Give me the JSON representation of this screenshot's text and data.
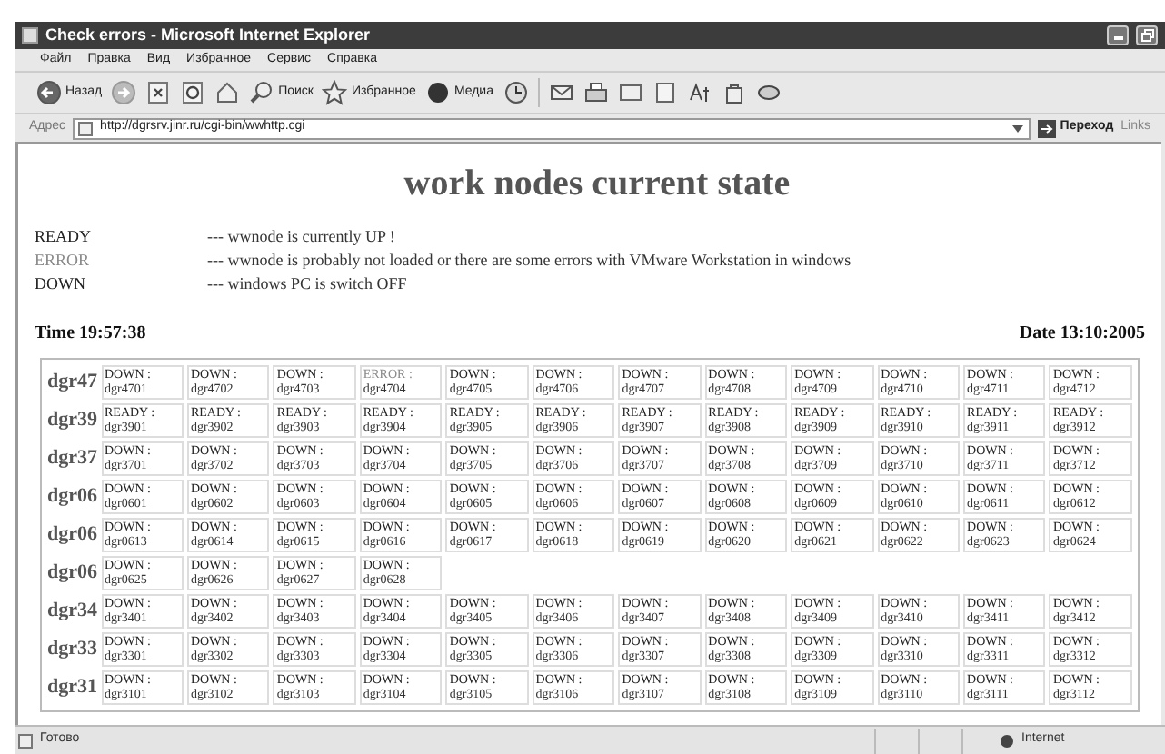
{
  "window": {
    "title": "Check errors - Microsoft Internet Explorer"
  },
  "menu": [
    "Файл",
    "Правка",
    "Вид",
    "Избранное",
    "Сервис",
    "Справка"
  ],
  "toolbar": {
    "back": "Назад",
    "search": "Поиск",
    "favorites": "Избранное",
    "media": "Медиа"
  },
  "address": {
    "label": "Адрес",
    "url": "http://dgrsrv.jinr.ru/cgi-bin/wwhttp.cgi",
    "go": "Переход",
    "links": "Links"
  },
  "page": {
    "heading": "work nodes current state",
    "legend": [
      {
        "kind": "ready",
        "state": "READY",
        "description": "--- wwnode is currently UP !"
      },
      {
        "kind": "error",
        "state": "ERROR",
        "description": "--- wwnode is probably not loaded or there are some errors with VMware Workstation in windows"
      },
      {
        "kind": "down",
        "state": "DOWN",
        "description": "--- windows PC is switch OFF"
      }
    ],
    "time": "Time 19:57:38",
    "date": "Date 13:10:2005",
    "groups": [
      {
        "name": "dgr47",
        "nodes": [
          {
            "kind": "down",
            "status": "DOWN :",
            "node": "dgr4701"
          },
          {
            "kind": "down",
            "status": "DOWN :",
            "node": "dgr4702"
          },
          {
            "kind": "down",
            "status": "DOWN :",
            "node": "dgr4703"
          },
          {
            "kind": "error",
            "status": "ERROR :",
            "node": "dgr4704"
          },
          {
            "kind": "down",
            "status": "DOWN :",
            "node": "dgr4705"
          },
          {
            "kind": "down",
            "status": "DOWN :",
            "node": "dgr4706"
          },
          {
            "kind": "down",
            "status": "DOWN :",
            "node": "dgr4707"
          },
          {
            "kind": "down",
            "status": "DOWN :",
            "node": "dgr4708"
          },
          {
            "kind": "down",
            "status": "DOWN :",
            "node": "dgr4709"
          },
          {
            "kind": "down",
            "status": "DOWN :",
            "node": "dgr4710"
          },
          {
            "kind": "down",
            "status": "DOWN :",
            "node": "dgr4711"
          },
          {
            "kind": "down",
            "status": "DOWN :",
            "node": "dgr4712"
          }
        ]
      },
      {
        "name": "dgr39",
        "nodes": [
          {
            "kind": "ready",
            "status": "READY :",
            "node": "dgr3901"
          },
          {
            "kind": "ready",
            "status": "READY :",
            "node": "dgr3902"
          },
          {
            "kind": "ready",
            "status": "READY :",
            "node": "dgr3903"
          },
          {
            "kind": "ready",
            "status": "READY :",
            "node": "dgr3904"
          },
          {
            "kind": "ready",
            "status": "READY :",
            "node": "dgr3905"
          },
          {
            "kind": "ready",
            "status": "READY :",
            "node": "dgr3906"
          },
          {
            "kind": "ready",
            "status": "READY :",
            "node": "dgr3907"
          },
          {
            "kind": "ready",
            "status": "READY :",
            "node": "dgr3908"
          },
          {
            "kind": "ready",
            "status": "READY :",
            "node": "dgr3909"
          },
          {
            "kind": "ready",
            "status": "READY :",
            "node": "dgr3910"
          },
          {
            "kind": "ready",
            "status": "READY :",
            "node": "dgr3911"
          },
          {
            "kind": "ready",
            "status": "READY :",
            "node": "dgr3912"
          }
        ]
      },
      {
        "name": "dgr37",
        "nodes": [
          {
            "kind": "down",
            "status": "DOWN :",
            "node": "dgr3701"
          },
          {
            "kind": "down",
            "status": "DOWN :",
            "node": "dgr3702"
          },
          {
            "kind": "down",
            "status": "DOWN :",
            "node": "dgr3703"
          },
          {
            "kind": "down",
            "status": "DOWN :",
            "node": "dgr3704"
          },
          {
            "kind": "down",
            "status": "DOWN :",
            "node": "dgr3705"
          },
          {
            "kind": "down",
            "status": "DOWN :",
            "node": "dgr3706"
          },
          {
            "kind": "down",
            "status": "DOWN :",
            "node": "dgr3707"
          },
          {
            "kind": "down",
            "status": "DOWN :",
            "node": "dgr3708"
          },
          {
            "kind": "down",
            "status": "DOWN :",
            "node": "dgr3709"
          },
          {
            "kind": "down",
            "status": "DOWN :",
            "node": "dgr3710"
          },
          {
            "kind": "down",
            "status": "DOWN :",
            "node": "dgr3711"
          },
          {
            "kind": "down",
            "status": "DOWN :",
            "node": "dgr3712"
          }
        ]
      },
      {
        "name": "dgr06",
        "nodes": [
          {
            "kind": "down",
            "status": "DOWN :",
            "node": "dgr0601"
          },
          {
            "kind": "down",
            "status": "DOWN :",
            "node": "dgr0602"
          },
          {
            "kind": "down",
            "status": "DOWN :",
            "node": "dgr0603"
          },
          {
            "kind": "down",
            "status": "DOWN :",
            "node": "dgr0604"
          },
          {
            "kind": "down",
            "status": "DOWN :",
            "node": "dgr0605"
          },
          {
            "kind": "down",
            "status": "DOWN :",
            "node": "dgr0606"
          },
          {
            "kind": "down",
            "status": "DOWN :",
            "node": "dgr0607"
          },
          {
            "kind": "down",
            "status": "DOWN :",
            "node": "dgr0608"
          },
          {
            "kind": "down",
            "status": "DOWN :",
            "node": "dgr0609"
          },
          {
            "kind": "down",
            "status": "DOWN :",
            "node": "dgr0610"
          },
          {
            "kind": "down",
            "status": "DOWN :",
            "node": "dgr0611"
          },
          {
            "kind": "down",
            "status": "DOWN :",
            "node": "dgr0612"
          }
        ]
      },
      {
        "name": "dgr06",
        "nodes": [
          {
            "kind": "down",
            "status": "DOWN :",
            "node": "dgr0613"
          },
          {
            "kind": "down",
            "status": "DOWN :",
            "node": "dgr0614"
          },
          {
            "kind": "down",
            "status": "DOWN :",
            "node": "dgr0615"
          },
          {
            "kind": "down",
            "status": "DOWN :",
            "node": "dgr0616"
          },
          {
            "kind": "down",
            "status": "DOWN :",
            "node": "dgr0617"
          },
          {
            "kind": "down",
            "status": "DOWN :",
            "node": "dgr0618"
          },
          {
            "kind": "down",
            "status": "DOWN :",
            "node": "dgr0619"
          },
          {
            "kind": "down",
            "status": "DOWN :",
            "node": "dgr0620"
          },
          {
            "kind": "down",
            "status": "DOWN :",
            "node": "dgr0621"
          },
          {
            "kind": "down",
            "status": "DOWN :",
            "node": "dgr0622"
          },
          {
            "kind": "down",
            "status": "DOWN :",
            "node": "dgr0623"
          },
          {
            "kind": "down",
            "status": "DOWN :",
            "node": "dgr0624"
          }
        ]
      },
      {
        "name": "dgr06",
        "nodes": [
          {
            "kind": "down",
            "status": "DOWN :",
            "node": "dgr0625"
          },
          {
            "kind": "down",
            "status": "DOWN :",
            "node": "dgr0626"
          },
          {
            "kind": "down",
            "status": "DOWN :",
            "node": "dgr0627"
          },
          {
            "kind": "down",
            "status": "DOWN :",
            "node": "dgr0628"
          }
        ]
      },
      {
        "name": "dgr34",
        "nodes": [
          {
            "kind": "down",
            "status": "DOWN :",
            "node": "dgr3401"
          },
          {
            "kind": "down",
            "status": "DOWN :",
            "node": "dgr3402"
          },
          {
            "kind": "down",
            "status": "DOWN :",
            "node": "dgr3403"
          },
          {
            "kind": "down",
            "status": "DOWN :",
            "node": "dgr3404"
          },
          {
            "kind": "down",
            "status": "DOWN :",
            "node": "dgr3405"
          },
          {
            "kind": "down",
            "status": "DOWN :",
            "node": "dgr3406"
          },
          {
            "kind": "down",
            "status": "DOWN :",
            "node": "dgr3407"
          },
          {
            "kind": "down",
            "status": "DOWN :",
            "node": "dgr3408"
          },
          {
            "kind": "down",
            "status": "DOWN :",
            "node": "dgr3409"
          },
          {
            "kind": "down",
            "status": "DOWN :",
            "node": "dgr3410"
          },
          {
            "kind": "down",
            "status": "DOWN :",
            "node": "dgr3411"
          },
          {
            "kind": "down",
            "status": "DOWN :",
            "node": "dgr3412"
          }
        ]
      },
      {
        "name": "dgr33",
        "nodes": [
          {
            "kind": "down",
            "status": "DOWN :",
            "node": "dgr3301"
          },
          {
            "kind": "down",
            "status": "DOWN :",
            "node": "dgr3302"
          },
          {
            "kind": "down",
            "status": "DOWN :",
            "node": "dgr3303"
          },
          {
            "kind": "down",
            "status": "DOWN :",
            "node": "dgr3304"
          },
          {
            "kind": "down",
            "status": "DOWN :",
            "node": "dgr3305"
          },
          {
            "kind": "down",
            "status": "DOWN :",
            "node": "dgr3306"
          },
          {
            "kind": "down",
            "status": "DOWN :",
            "node": "dgr3307"
          },
          {
            "kind": "down",
            "status": "DOWN :",
            "node": "dgr3308"
          },
          {
            "kind": "down",
            "status": "DOWN :",
            "node": "dgr3309"
          },
          {
            "kind": "down",
            "status": "DOWN :",
            "node": "dgr3310"
          },
          {
            "kind": "down",
            "status": "DOWN :",
            "node": "dgr3311"
          },
          {
            "kind": "down",
            "status": "DOWN :",
            "node": "dgr3312"
          }
        ]
      },
      {
        "name": "dgr31",
        "nodes": [
          {
            "kind": "down",
            "status": "DOWN :",
            "node": "dgr3101"
          },
          {
            "kind": "down",
            "status": "DOWN :",
            "node": "dgr3102"
          },
          {
            "kind": "down",
            "status": "DOWN :",
            "node": "dgr3103"
          },
          {
            "kind": "down",
            "status": "DOWN :",
            "node": "dgr3104"
          },
          {
            "kind": "down",
            "status": "DOWN :",
            "node": "dgr3105"
          },
          {
            "kind": "down",
            "status": "DOWN :",
            "node": "dgr3106"
          },
          {
            "kind": "down",
            "status": "DOWN :",
            "node": "dgr3107"
          },
          {
            "kind": "down",
            "status": "DOWN :",
            "node": "dgr3108"
          },
          {
            "kind": "down",
            "status": "DOWN :",
            "node": "dgr3109"
          },
          {
            "kind": "down",
            "status": "DOWN :",
            "node": "dgr3110"
          },
          {
            "kind": "down",
            "status": "DOWN :",
            "node": "dgr3111"
          },
          {
            "kind": "down",
            "status": "DOWN :",
            "node": "dgr3112"
          }
        ]
      }
    ]
  },
  "status_bar": {
    "text": "Готово",
    "zone": "Internet"
  }
}
